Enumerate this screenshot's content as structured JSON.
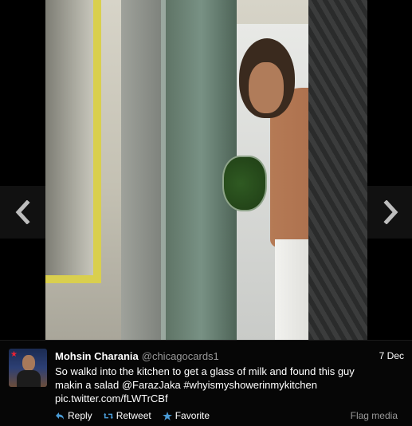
{
  "viewer": {
    "prev_icon": "chevron-left-icon",
    "next_icon": "chevron-right-icon"
  },
  "tweet": {
    "name": "Mohsin Charania",
    "handle": "@chicagocards1",
    "date": "7 Dec",
    "text_lines": [
      "So walkd into the kitchen to get a glass of milk and found this guy",
      "makin a salad @FarazJaka #whyismyshowerinmykitchen",
      "pic.twitter.com/fLWTrCBf"
    ],
    "actions": {
      "reply": "Reply",
      "retweet": "Retweet",
      "favorite": "Favorite",
      "flag": "Flag media"
    },
    "colors": {
      "action_icon": "#4a9bd6",
      "handle": "#999999"
    }
  }
}
